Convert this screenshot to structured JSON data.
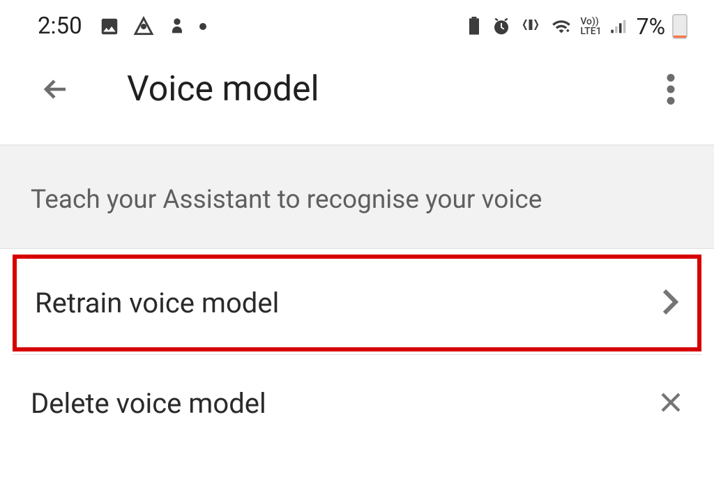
{
  "statusBar": {
    "time": "2:50",
    "batteryPercent": "7%"
  },
  "header": {
    "title": "Voice model"
  },
  "section": {
    "subtitle": "Teach your Assistant to recognise your voice"
  },
  "items": {
    "retrain": "Retrain voice model",
    "delete": "Delete voice model"
  },
  "lte": {
    "top": "Vo))",
    "bottom": "LTE1"
  }
}
